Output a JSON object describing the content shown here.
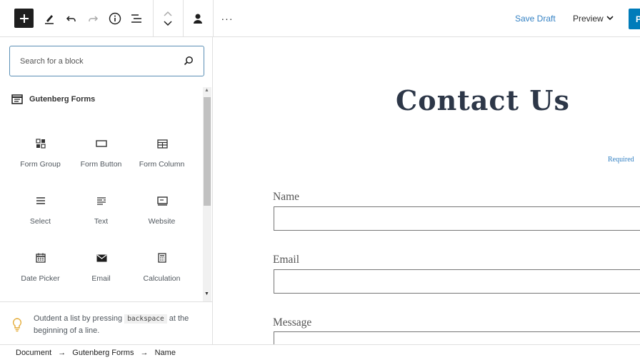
{
  "toolbar": {
    "save_draft": "Save Draft",
    "preview": "Preview",
    "publish_partial": "P",
    "more": "···"
  },
  "inserter": {
    "search_placeholder": "Search for a block",
    "category": "Gutenberg Forms",
    "blocks": [
      {
        "label": "Form Group",
        "icon": "form-group-icon"
      },
      {
        "label": "Form Button",
        "icon": "form-button-icon"
      },
      {
        "label": "Form Column",
        "icon": "form-column-icon"
      },
      {
        "label": "Select",
        "icon": "select-icon"
      },
      {
        "label": "Text",
        "icon": "text-icon"
      },
      {
        "label": "Website",
        "icon": "website-icon"
      },
      {
        "label": "Date Picker",
        "icon": "calendar-icon"
      },
      {
        "label": "Email",
        "icon": "envelope-icon"
      },
      {
        "label": "Calculation",
        "icon": "calculator-icon"
      }
    ],
    "tip": {
      "before": "Outdent a list by pressing",
      "key": "backspace",
      "after": "at the beginning of a line."
    }
  },
  "canvas": {
    "title": "Contact Us",
    "required": "Required",
    "fields": [
      {
        "label": "Name"
      },
      {
        "label": "Email"
      },
      {
        "label": "Message"
      }
    ]
  },
  "breadcrumb": {
    "items": [
      "Document",
      "Gutenberg Forms",
      "Name"
    ],
    "separator": "→"
  },
  "colors": {
    "accent": "#007cba",
    "link": "#3582c4",
    "heading": "#2d3748"
  }
}
